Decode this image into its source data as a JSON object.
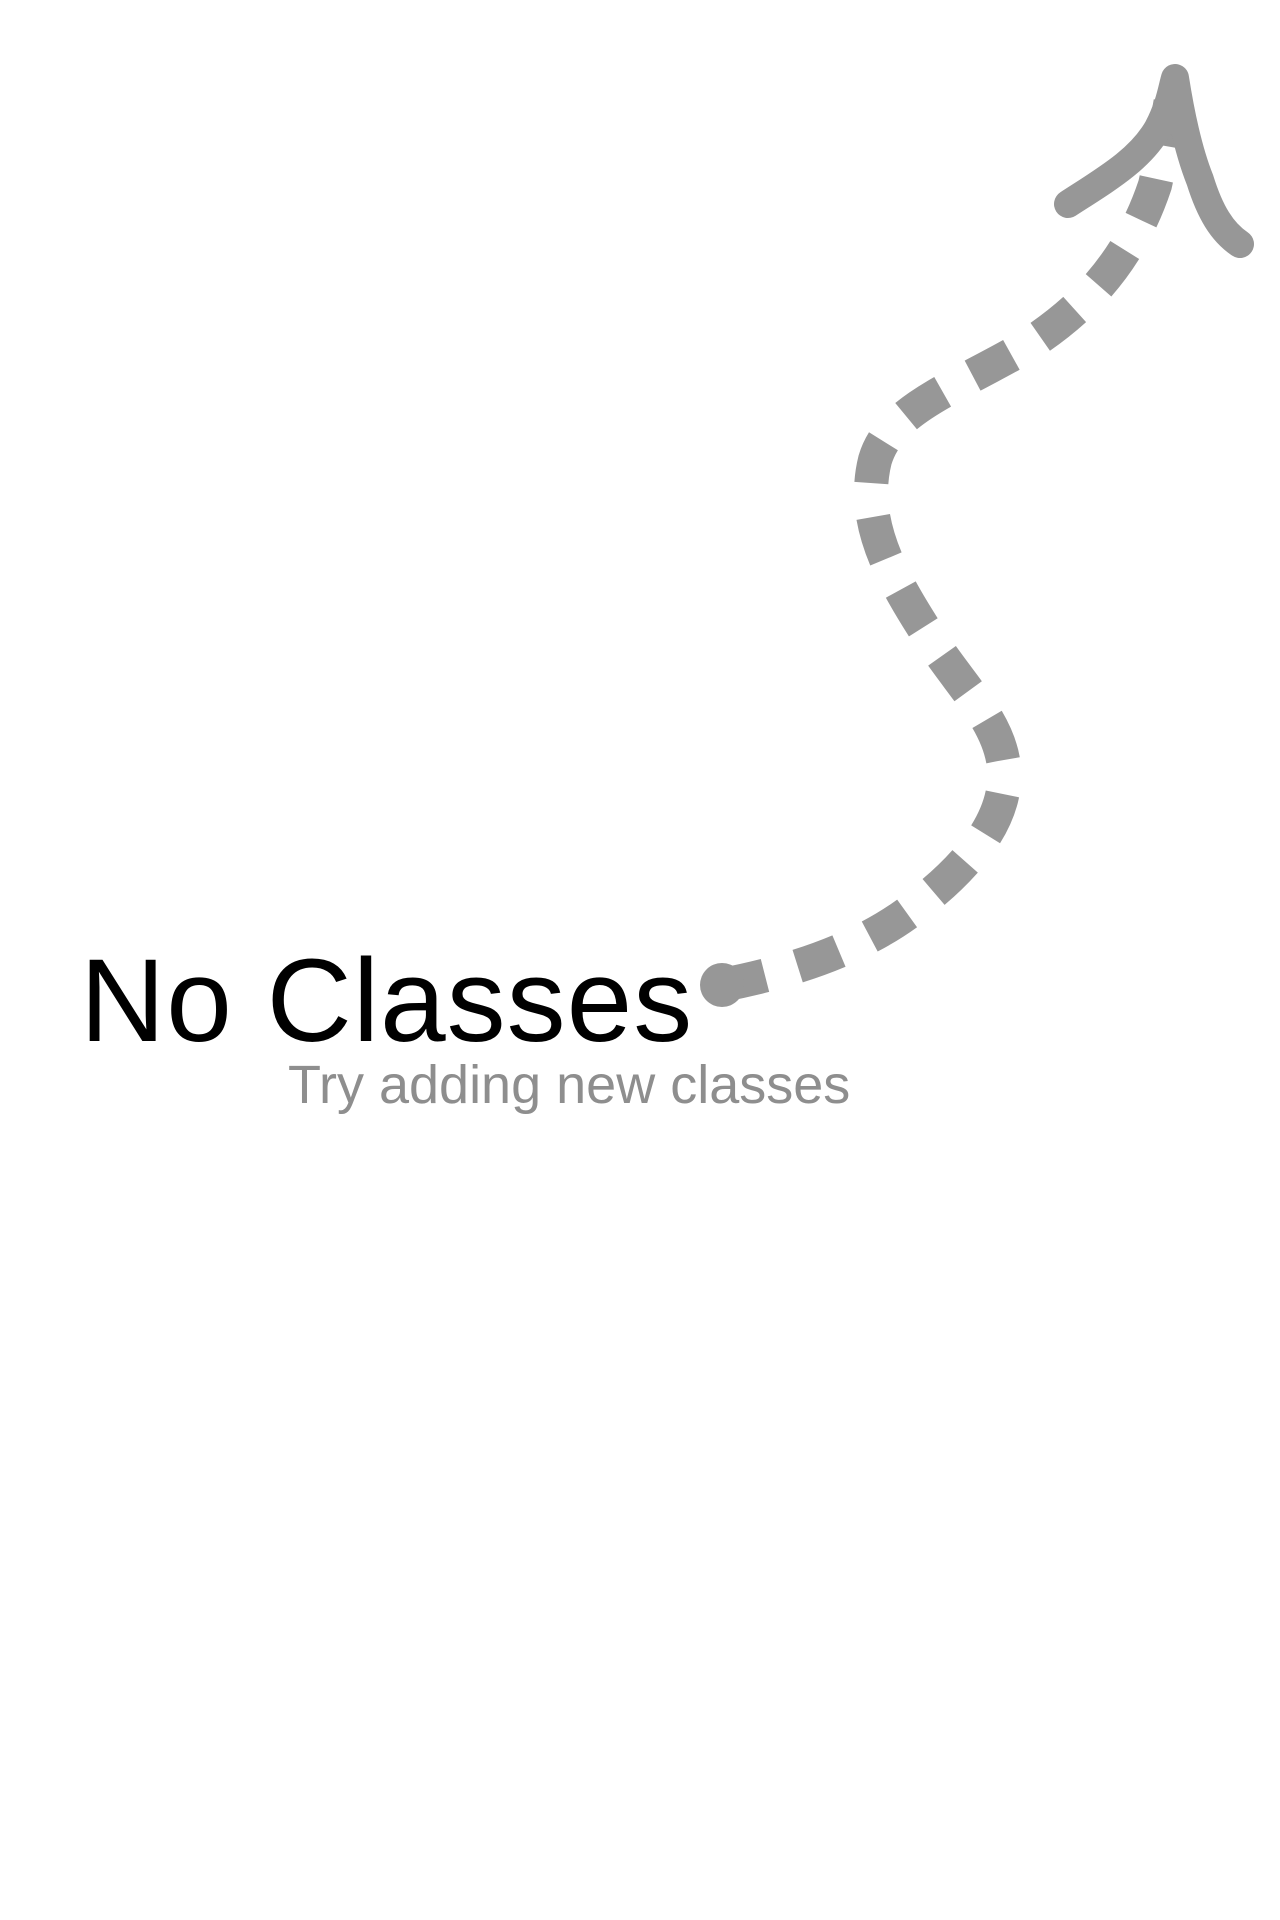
{
  "empty_state": {
    "title": "No Classes",
    "subtitle": "Try adding new classes",
    "arrow_icon": "curved-dashed-arrow-up-right",
    "arrow_color": "#979797",
    "title_color": "#000000",
    "subtitle_color": "#8e8e8e"
  }
}
